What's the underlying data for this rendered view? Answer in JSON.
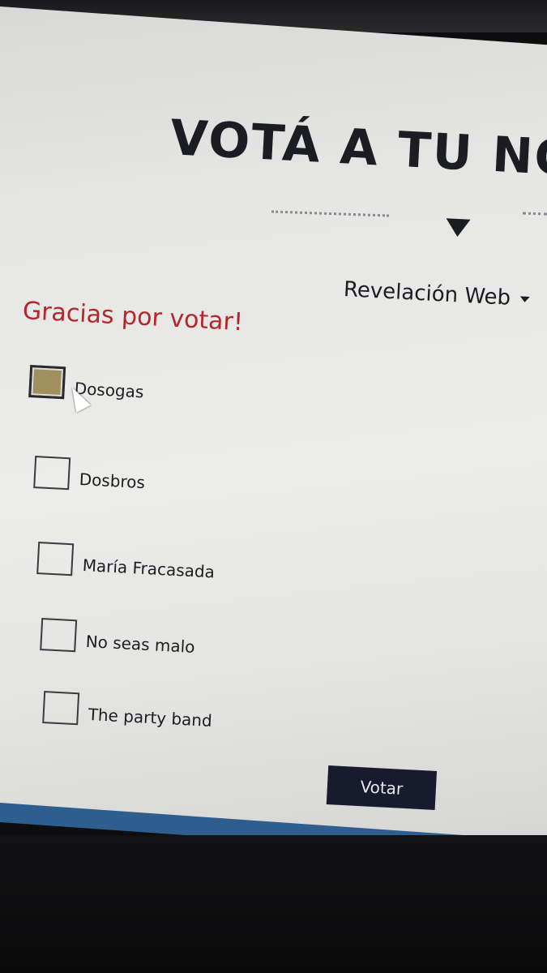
{
  "header": {
    "title": "VOTÁ A TU NO"
  },
  "category": {
    "selected": "Revelación Web"
  },
  "status": {
    "message": "Gracias por votar!"
  },
  "options": [
    {
      "label": "Dosogas",
      "checked": true
    },
    {
      "label": "Dosbros",
      "checked": false
    },
    {
      "label": "María Fracasada",
      "checked": false
    },
    {
      "label": "No seas malo",
      "checked": false
    },
    {
      "label": "The party band",
      "checked": false
    }
  ],
  "actions": {
    "vote_label": "Votar"
  },
  "colors": {
    "accent_red": "#b3262a",
    "button_bg": "#181a2e",
    "checked_fill": "#a09060",
    "text": "#1c1c24"
  },
  "icons": {
    "divider": "chevron-down-icon",
    "cursor": "mouse-pointer-icon"
  }
}
